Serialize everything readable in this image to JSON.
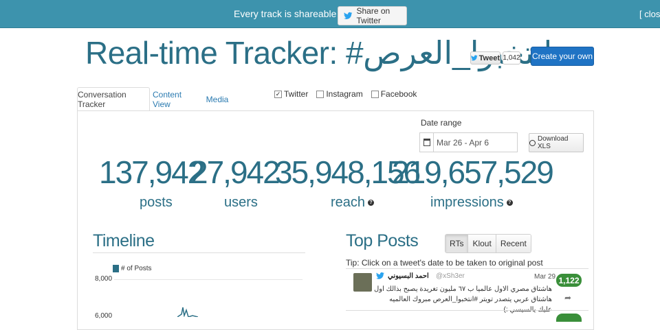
{
  "banner": {
    "message": "Every track is shareable →",
    "share_label": "Share on Twitter",
    "close_label": "[ close"
  },
  "header": {
    "title": "Real-time Tracker: #انتخبوا_العرص",
    "tweet_label": "Tweet",
    "tweet_count": "1,042",
    "create_label": "Create your own"
  },
  "tabs": [
    {
      "label": "Conversation Tracker",
      "active": true
    },
    {
      "label": "Content View",
      "active": false
    },
    {
      "label": "Media",
      "active": false
    }
  ],
  "sources": [
    {
      "label": "Twitter",
      "checked": true
    },
    {
      "label": "Instagram",
      "checked": false
    },
    {
      "label": "Facebook",
      "checked": false
    }
  ],
  "date_range": {
    "label": "Date range",
    "value": "Mar 26 - Apr 6",
    "download_label": "Download XLS"
  },
  "stats": [
    {
      "value": "137,942",
      "label": "posts",
      "info": false
    },
    {
      "value": "27,942",
      "label": "users",
      "info": false
    },
    {
      "value": "35,948,156",
      "label": "reach",
      "info": true
    },
    {
      "value": "219,657,529",
      "label": "impressions",
      "info": true
    }
  ],
  "timeline": {
    "title": "Timeline",
    "legend": "# of Posts",
    "yticks": [
      "8,000",
      "6,000"
    ]
  },
  "top_posts": {
    "title": "Top Posts",
    "segments": [
      "RTs",
      "Klout",
      "Recent"
    ],
    "active_segment": "RTs",
    "tip": "Tip: Click on a tweet's date to be taken to original post",
    "posts": [
      {
        "author": "احمد البسيوني",
        "handle": "@xSh3er",
        "date": "Mar 29",
        "text": "هاشتاق مصري الاول عالميا ب ٦٧ مليون تغريدة يصبح بذالك اول هاشتاق عربي يتصدر تويتر #انتخبوا_العرص مبروك العالميه عليك يالسيسي :)",
        "rt_count": "1,122"
      }
    ]
  },
  "colors": {
    "banner_bg": "#3d93ad",
    "accent": "#2b6f86",
    "primary_button": "#1f73c4",
    "badge_green": "#3a8f3a"
  }
}
